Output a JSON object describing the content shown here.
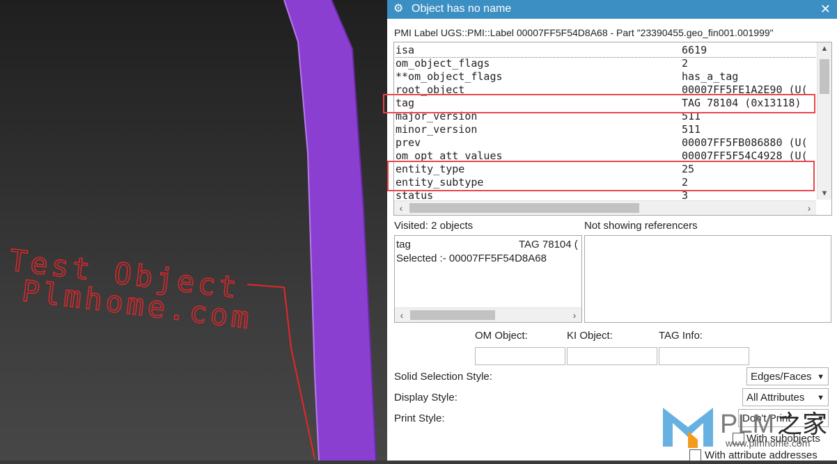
{
  "dialog": {
    "title": "Object has no name",
    "gear_icon": "gear-icon",
    "close_icon": "close-icon",
    "header": "PMI Label UGS::PMI::Label 00007FF5F54D8A68 - Part \"23390455.geo_fin001.001999\"",
    "attributes": [
      {
        "key": "isa",
        "value": "6619"
      },
      {
        "key": "om_object_flags",
        "value": "2"
      },
      {
        "key": "**om_object_flags",
        "value": "has_a_tag"
      },
      {
        "key": "root_object",
        "value": "00007FF5FE1A2E90 (U("
      },
      {
        "key": "tag",
        "value": "TAG 78104 (0x13118)"
      },
      {
        "key": "major_version",
        "value": "511"
      },
      {
        "key": "minor_version",
        "value": "511"
      },
      {
        "key": "prev",
        "value": "00007FF5FB086880 (U("
      },
      {
        "key": "om_opt_att_values",
        "value": "00007FF5F54C4928 (U("
      },
      {
        "key": "entity_type",
        "value": "25"
      },
      {
        "key": "entity_subtype",
        "value": "2"
      },
      {
        "key": "status",
        "value": "3"
      }
    ],
    "visited_label": "Visited: 2 objects",
    "referencers_label": "Not showing referencers",
    "visited_items": [
      {
        "key": "tag",
        "value": "TAG 78104 ("
      },
      {
        "key": "Selected :- 00007FF5F54D8A68",
        "value": ""
      }
    ],
    "om_object_label": "OM Object:",
    "ki_object_label": "KI Object:",
    "tag_info_label": "TAG Info:",
    "solid_selection_label": "Solid Selection Style:",
    "solid_selection_value": "Edges/Faces",
    "display_style_label": "Display Style:",
    "display_style_value": "All Attributes",
    "print_style_label": "Print Style:",
    "print_style_value": "Don't Print",
    "with_subobjects_label": "With subobjects",
    "with_attr_addresses_label": "With attribute addresses"
  },
  "viewport": {
    "annotation_line1": "Test Object",
    "annotation_line2": "Plmhome.com",
    "annotation_color": "#e8262a",
    "part_color": "#8a3fd0"
  },
  "watermark": {
    "brand": "PLM",
    "chinese": "之家",
    "url": "www.plmhome.com"
  },
  "colors": {
    "titlebar": "#3c8fc2",
    "highlight_box": "#e8454b"
  }
}
